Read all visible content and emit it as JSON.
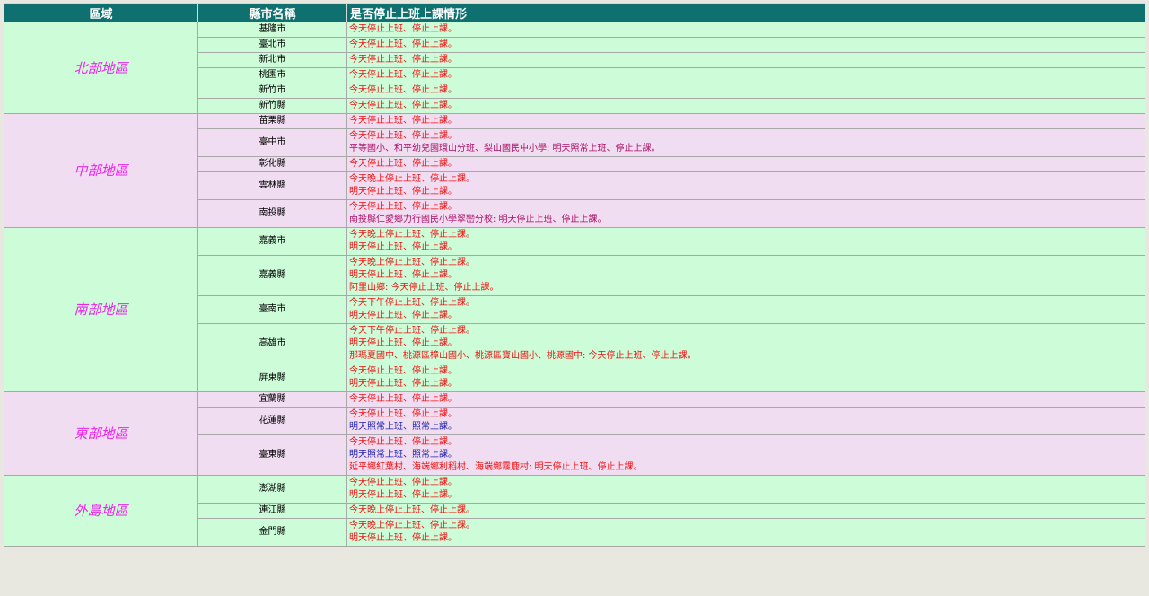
{
  "headers": {
    "region": "區域",
    "city": "縣市名稱",
    "status": "是否停止上班上課情形"
  },
  "groups": [
    {
      "region": "北部地區",
      "bg": "green",
      "rows": [
        {
          "city": "基隆市",
          "lines": [
            {
              "text": "今天停止上班、停止上課。",
              "color": "red"
            }
          ]
        },
        {
          "city": "臺北市",
          "lines": [
            {
              "text": "今天停止上班、停止上課。",
              "color": "red"
            }
          ]
        },
        {
          "city": "新北市",
          "lines": [
            {
              "text": "今天停止上班、停止上課。",
              "color": "red"
            }
          ]
        },
        {
          "city": "桃園市",
          "lines": [
            {
              "text": "今天停止上班、停止上課。",
              "color": "red"
            }
          ]
        },
        {
          "city": "新竹市",
          "lines": [
            {
              "text": "今天停止上班、停止上課。",
              "color": "red"
            }
          ]
        },
        {
          "city": "新竹縣",
          "lines": [
            {
              "text": "今天停止上班、停止上課。",
              "color": "red"
            }
          ]
        }
      ]
    },
    {
      "region": "中部地區",
      "bg": "pink",
      "rows": [
        {
          "city": "苗栗縣",
          "lines": [
            {
              "text": "今天停止上班、停止上課。",
              "color": "red"
            }
          ]
        },
        {
          "city": "臺中市",
          "lines": [
            {
              "text": "今天停止上班、停止上課。",
              "color": "red"
            },
            {
              "text": "平等國小、和平幼兒園環山分班、梨山國民中小學: 明天照常上班、停止上課。",
              "color": "purple"
            }
          ]
        },
        {
          "city": "彰化縣",
          "lines": [
            {
              "text": "今天停止上班、停止上課。",
              "color": "red"
            }
          ]
        },
        {
          "city": "雲林縣",
          "lines": [
            {
              "text": "今天晚上停止上班、停止上課。",
              "color": "red"
            },
            {
              "text": "明天停止上班、停止上課。",
              "color": "red"
            }
          ]
        },
        {
          "city": "南投縣",
          "lines": [
            {
              "text": "今天停止上班、停止上課。",
              "color": "red"
            },
            {
              "text": "南投縣仁愛鄉力行國民小學翠巒分校: 明天停止上班、停止上課。",
              "color": "purple"
            }
          ]
        }
      ]
    },
    {
      "region": "南部地區",
      "bg": "green",
      "rows": [
        {
          "city": "嘉義市",
          "lines": [
            {
              "text": "今天晚上停止上班、停止上課。",
              "color": "red"
            },
            {
              "text": "明天停止上班、停止上課。",
              "color": "red"
            }
          ]
        },
        {
          "city": "嘉義縣",
          "lines": [
            {
              "text": "今天晚上停止上班、停止上課。",
              "color": "red"
            },
            {
              "text": "明天停止上班、停止上課。",
              "color": "red"
            },
            {
              "text": "阿里山鄉: 今天停止上班、停止上課。",
              "color": "red"
            }
          ]
        },
        {
          "city": "臺南市",
          "lines": [
            {
              "text": "今天下午停止上班、停止上課。",
              "color": "red"
            },
            {
              "text": "明天停止上班、停止上課。",
              "color": "red"
            }
          ]
        },
        {
          "city": "高雄市",
          "lines": [
            {
              "text": "今天下午停止上班、停止上課。",
              "color": "red"
            },
            {
              "text": "明天停止上班、停止上課。",
              "color": "red"
            },
            {
              "text": "那瑪夏國中、桃源區樟山國小、桃源區寶山國小、桃源國中: 今天停止上班、停止上課。",
              "color": "red"
            }
          ]
        },
        {
          "city": "屏東縣",
          "lines": [
            {
              "text": "今天停止上班、停止上課。",
              "color": "red"
            },
            {
              "text": "明天停止上班、停止上課。",
              "color": "red"
            }
          ]
        }
      ]
    },
    {
      "region": "東部地區",
      "bg": "pink",
      "rows": [
        {
          "city": "宜蘭縣",
          "lines": [
            {
              "text": "今天停止上班、停止上課。",
              "color": "red"
            }
          ]
        },
        {
          "city": "花蓮縣",
          "lines": [
            {
              "text": "今天停止上班、停止上課。",
              "color": "red"
            },
            {
              "text": "明天照常上班、照常上課。",
              "color": "blue"
            }
          ]
        },
        {
          "city": "臺東縣",
          "lines": [
            {
              "text": "今天停止上班、停止上課。",
              "color": "red"
            },
            {
              "text": "明天照常上班、照常上課。",
              "color": "blue"
            },
            {
              "text": "延平鄉紅葉村、海端鄉利稻村、海端鄉霧鹿村: 明天停止上班、停止上課。",
              "color": "red"
            }
          ]
        }
      ]
    },
    {
      "region": "外島地區",
      "bg": "green",
      "rows": [
        {
          "city": "澎湖縣",
          "lines": [
            {
              "text": "今天停止上班、停止上課。",
              "color": "red"
            },
            {
              "text": "明天停止上班、停止上課。",
              "color": "red"
            }
          ]
        },
        {
          "city": "連江縣",
          "lines": [
            {
              "text": "今天晚上停止上班、停止上課。",
              "color": "red"
            }
          ]
        },
        {
          "city": "金門縣",
          "lines": [
            {
              "text": "今天晚上停止上班、停止上課。",
              "color": "red"
            },
            {
              "text": "明天停止上班、停止上課。",
              "color": "red"
            }
          ]
        }
      ]
    }
  ]
}
